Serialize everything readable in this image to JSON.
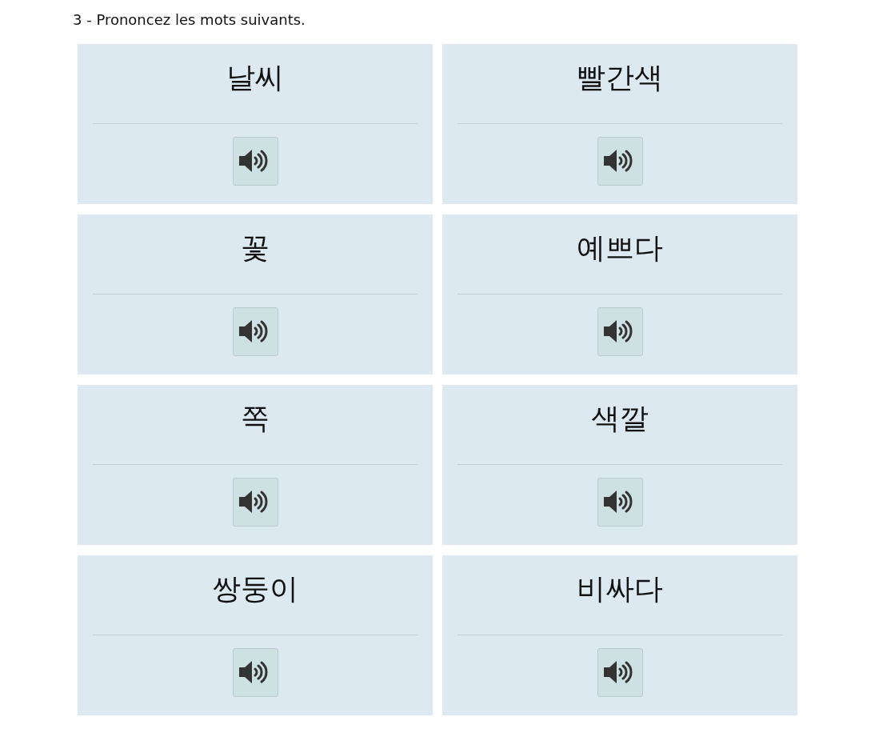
{
  "instruction": "3 - Prononcez les mots suivants.",
  "words": [
    {
      "word": "날씨"
    },
    {
      "word": "빨간색"
    },
    {
      "word": "꽃"
    },
    {
      "word": "예쁘다"
    },
    {
      "word": "쪽"
    },
    {
      "word": "색깔"
    },
    {
      "word": "쌍둥이"
    },
    {
      "word": "비싸다"
    }
  ]
}
